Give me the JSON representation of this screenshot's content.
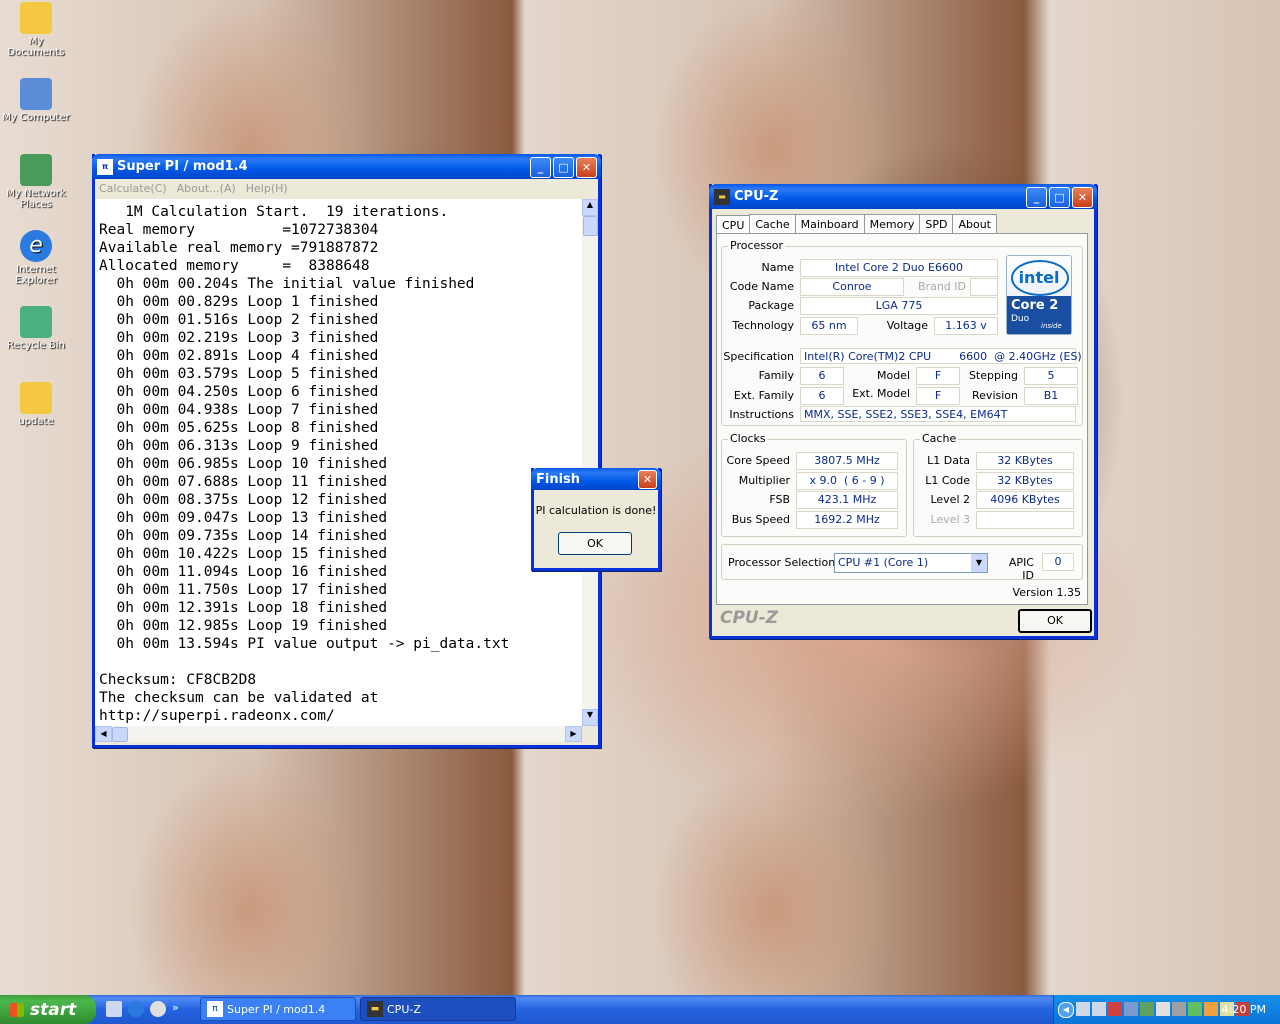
{
  "desktop_icons": [
    {
      "label": "My Documents",
      "icon": "folder-docs-icon",
      "color": "#f5c842"
    },
    {
      "label": "My Computer",
      "icon": "computer-icon",
      "color": "#5a8cd8"
    },
    {
      "label": "My Network Places",
      "icon": "network-icon",
      "color": "#4a9a5a"
    },
    {
      "label": "Internet Explorer",
      "icon": "ie-icon",
      "color": "#2a7ae0"
    },
    {
      "label": "Recycle Bin",
      "icon": "recycle-bin-icon",
      "color": "#4ab080"
    },
    {
      "label": "update",
      "icon": "folder-icon",
      "color": "#f5c842"
    }
  ],
  "superpi": {
    "title": "Super PI / mod1.4",
    "menu": [
      "Calculate(C)",
      "About...(A)",
      "Help(H)"
    ],
    "lines": [
      "   1M Calculation Start.  19 iterations.",
      "Real memory          =1072738304",
      "Available real memory =791887872",
      "Allocated memory     =  8388648",
      "  0h 00m 00.204s The initial value finished",
      "  0h 00m 00.829s Loop 1 finished",
      "  0h 00m 01.516s Loop 2 finished",
      "  0h 00m 02.219s Loop 3 finished",
      "  0h 00m 02.891s Loop 4 finished",
      "  0h 00m 03.579s Loop 5 finished",
      "  0h 00m 04.250s Loop 6 finished",
      "  0h 00m 04.938s Loop 7 finished",
      "  0h 00m 05.625s Loop 8 finished",
      "  0h 00m 06.313s Loop 9 finished",
      "  0h 00m 06.985s Loop 10 finished",
      "  0h 00m 07.688s Loop 11 finished",
      "  0h 00m 08.375s Loop 12 finished",
      "  0h 00m 09.047s Loop 13 finished",
      "  0h 00m 09.735s Loop 14 finished",
      "  0h 00m 10.422s Loop 15 finished",
      "  0h 00m 11.094s Loop 16 finished",
      "  0h 00m 11.750s Loop 17 finished",
      "  0h 00m 12.391s Loop 18 finished",
      "  0h 00m 12.985s Loop 19 finished",
      "  0h 00m 13.594s PI value output -> pi_data.txt",
      "",
      "Checksum: CF8CB2D8",
      "The checksum can be validated at",
      "http://superpi.radeonx.com/"
    ]
  },
  "finish": {
    "title": "Finish",
    "message": "PI calculation is done!",
    "ok": "OK"
  },
  "cpuz": {
    "title": "CPU-Z",
    "tabs": [
      "CPU",
      "Cache",
      "Mainboard",
      "Memory",
      "SPD",
      "About"
    ],
    "processor_label": "Processor",
    "name_label": "Name",
    "name": "Intel Core 2 Duo E6600",
    "codename_label": "Code Name",
    "codename": "Conroe",
    "brandid_label": "Brand ID",
    "package_label": "Package",
    "package": "LGA 775",
    "technology_label": "Technology",
    "technology": "65 nm",
    "voltage_label": "Voltage",
    "voltage": "1.163 v",
    "spec_label": "Specification",
    "spec": "Intel(R) Core(TM)2 CPU        6600  @ 2.40GHz (ES)",
    "family_label": "Family",
    "family": "6",
    "model_label": "Model",
    "model": "F",
    "stepping_label": "Stepping",
    "stepping": "5",
    "extfamily_label": "Ext. Family",
    "extfamily": "6",
    "extmodel_label": "Ext. Model",
    "extmodel": "F",
    "revision_label": "Revision",
    "revision": "B1",
    "instructions_label": "Instructions",
    "instructions": "MMX, SSE, SSE2, SSE3, SSE4, EM64T",
    "clocks_label": "Clocks",
    "corespeed_label": "Core Speed",
    "corespeed": "3807.5 MHz",
    "multiplier_label": "Multiplier",
    "multiplier": "x 9.0  ( 6 - 9 )",
    "fsb_label": "FSB",
    "fsb": "423.1 MHz",
    "busspeed_label": "Bus Speed",
    "busspeed": "1692.2 MHz",
    "cache_label": "Cache",
    "l1data_label": "L1 Data",
    "l1data": "32 KBytes",
    "l1code_label": "L1 Code",
    "l1code": "32 KBytes",
    "level2_label": "Level 2",
    "level2": "4096 KBytes",
    "level3_label": "Level 3",
    "procsel_label": "Processor Selection",
    "procsel": "CPU #1 (Core 1)",
    "apic_label": "APIC ID",
    "apic": "0",
    "version": "Version 1.35",
    "brand": "CPU-Z",
    "ok": "OK",
    "logo_intel": "intel",
    "logo_core": "Core 2",
    "logo_duo": "Duo",
    "logo_inside": "inside"
  },
  "taskbar": {
    "start": "start",
    "tasks": [
      "Super PI / mod1.4",
      "CPU-Z"
    ],
    "clock": "4:20 PM"
  }
}
